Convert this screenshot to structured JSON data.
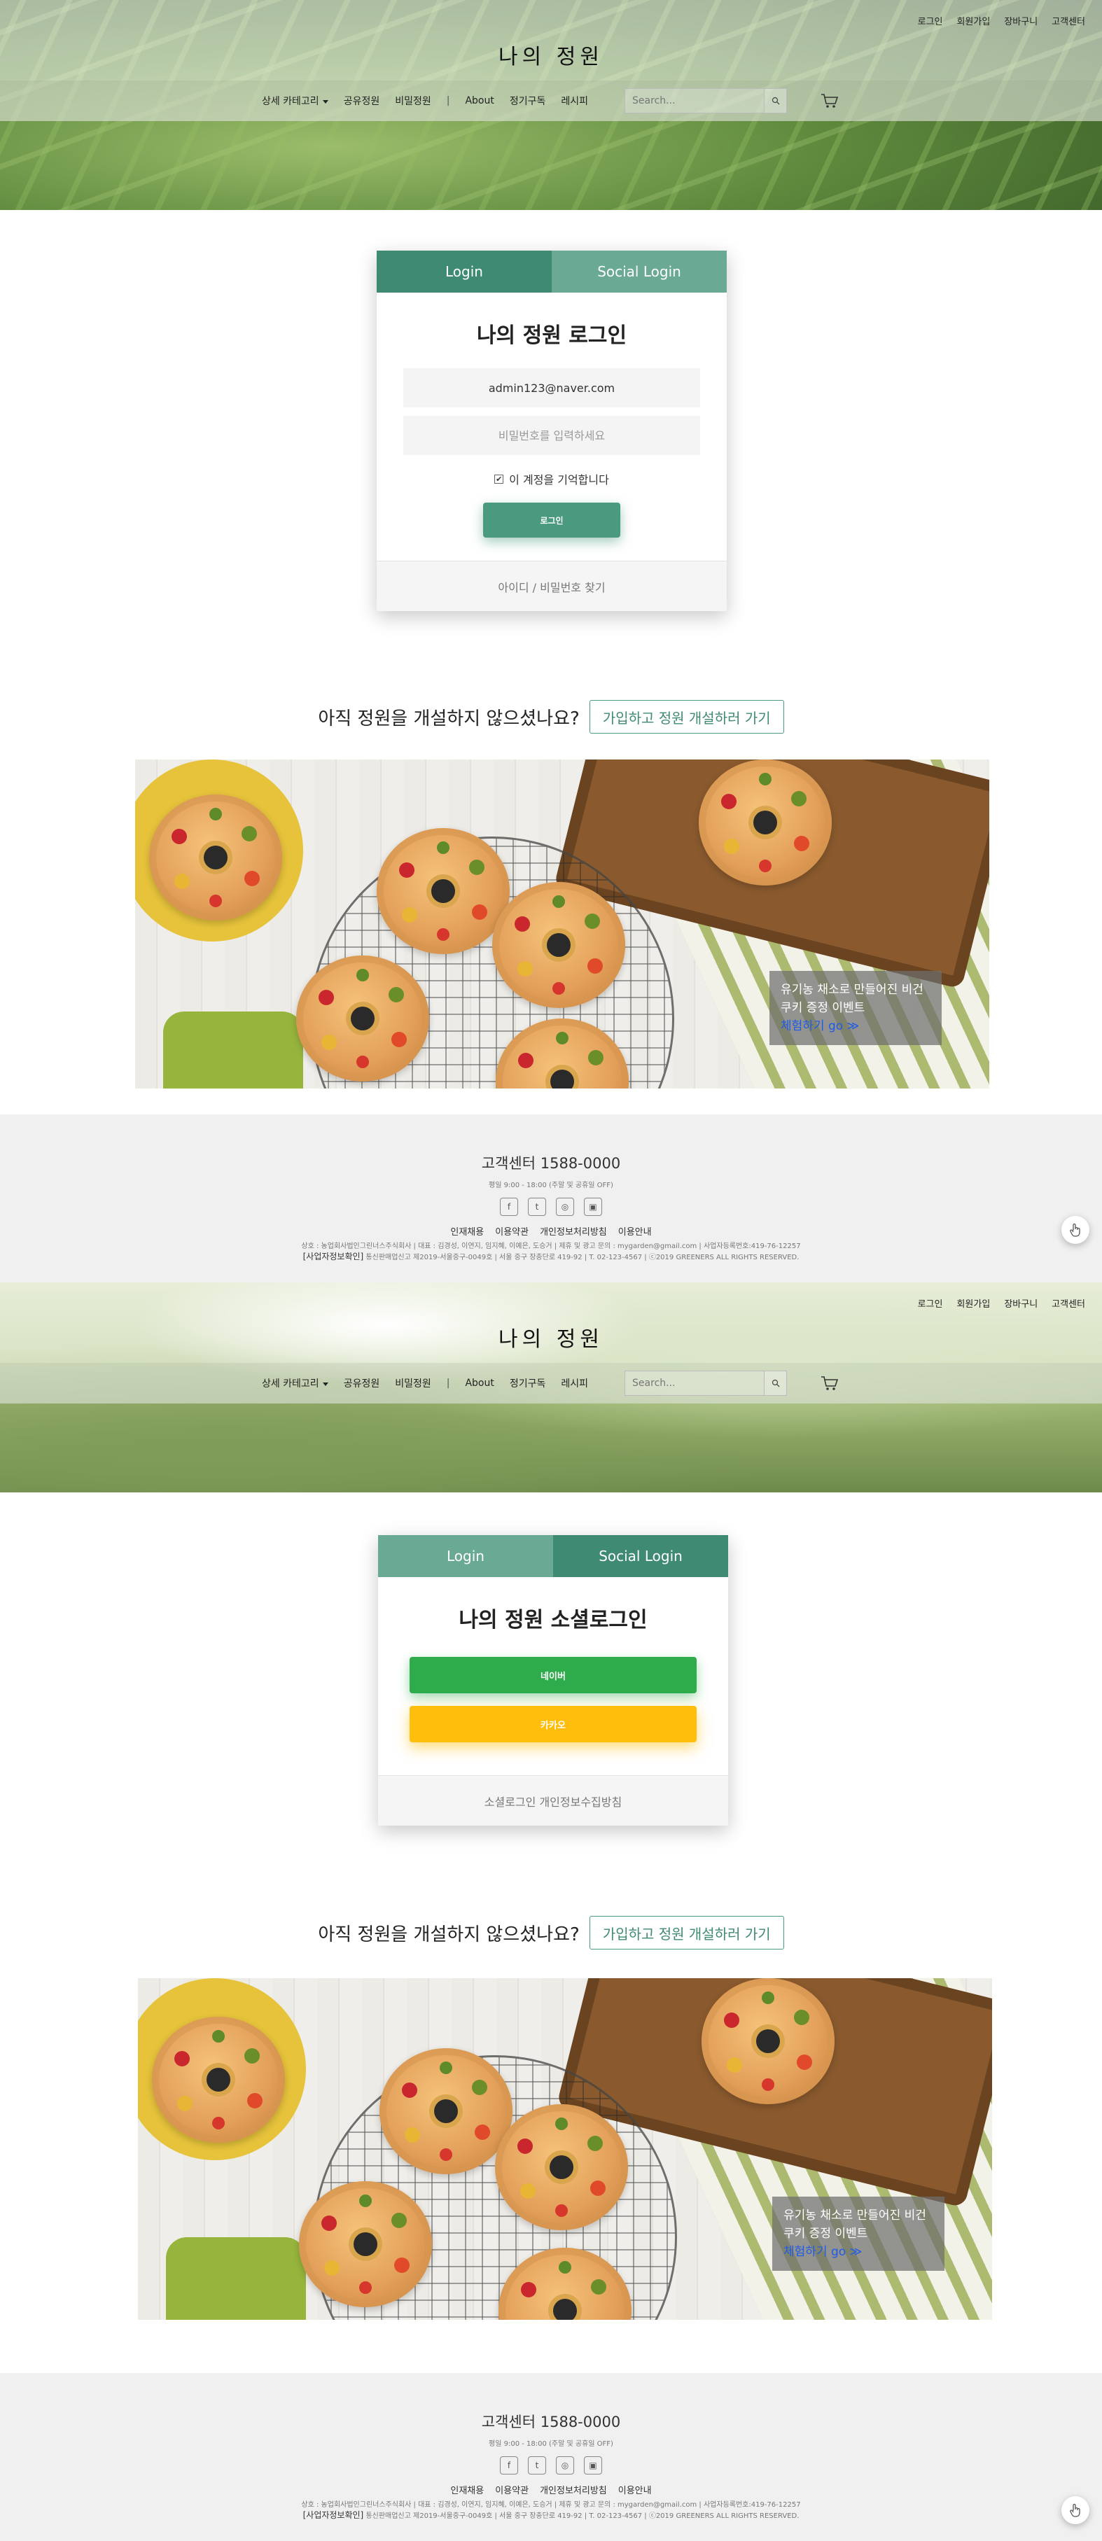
{
  "header": {
    "brand": "나의 정원",
    "top_links": [
      "로그인",
      "회원가입",
      "장바구니",
      "고객센터"
    ],
    "nav": {
      "category": "상세 카테고리",
      "items": [
        "공유정원",
        "비밀정원"
      ],
      "separator": "|",
      "items_right": [
        "About",
        "정기구독",
        "레시피"
      ]
    },
    "search_placeholder": "Search..."
  },
  "login_card": {
    "tab_login": "Login",
    "tab_social": "Social Login",
    "title": "나의 정원 로그인",
    "email_value": "admin123@naver.com",
    "password_placeholder": "비밀번호를 입력하세요",
    "remember_label": "이 계정을 기억합니다",
    "remember_checked": true,
    "submit_label": "로그인",
    "footer_link": "아이디 / 비밀번호 찾기"
  },
  "social_card": {
    "tab_login": "Login",
    "tab_social": "Social Login",
    "title": "나의 정원 소셜로그인",
    "naver_label": "네이버",
    "kakao_label": "카카오",
    "footer_link": "소셜로그인 개인정보수집방침"
  },
  "signup_prompt": {
    "text": "아직 정원을 개설하지 않으셨나요?",
    "button": "가입하고 정원 개설하러 가기"
  },
  "banner": {
    "line1": "유기농 채소로 만들어진 비건",
    "line2": "쿠키 증정 이벤트",
    "link": "체험하기 go ≫"
  },
  "footer": {
    "phone": "고객센터 1588-0000",
    "hours": "평일 9:00 - 18:00 (주말 및 공휴일 OFF)",
    "socials": [
      "f",
      "t",
      "◎",
      "▣"
    ],
    "links": [
      "인재채용",
      "이용약관",
      "개인정보처리방침",
      "이용안내"
    ],
    "info_line1": "상호 : 농업회사법인그린너스주식회사 | 대표 : 김경성, 이연지, 임지혜, 이예은, 도승거 | 제휴 및 광고 문의 : mygarden@gmail.com | 사업자등록번호:419-76-12257",
    "info_biz": "[사업자정보확인]",
    "info_line2": "통신판매업신고 제2019-서울중구-0049호 | 서울 중구 장충단로 419-92 | T. 02-123-4567 | ⓒ2019 GREENERS ALL RIGHTS RESERVED."
  },
  "colors": {
    "primary": "#3e8a72",
    "primary_light": "#6aaa94",
    "naver": "#2eab4a",
    "kakao": "#ffbe0b"
  }
}
